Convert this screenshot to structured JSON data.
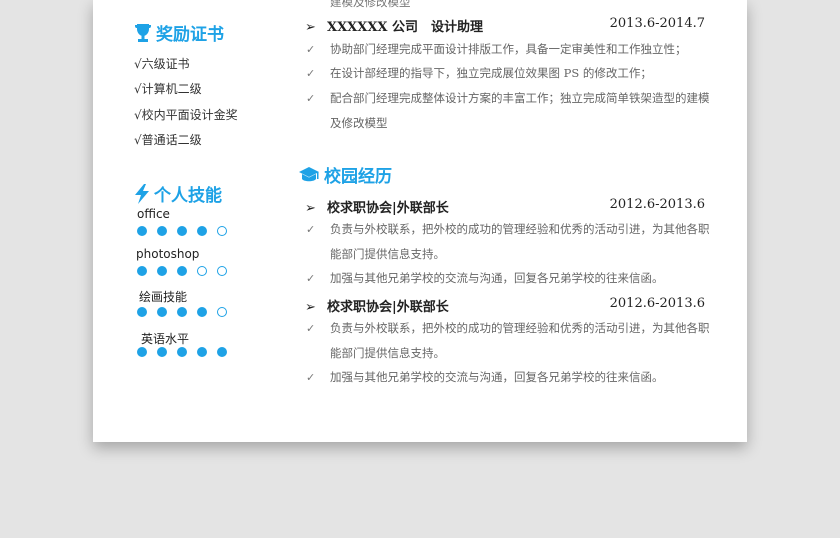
{
  "colors": {
    "accent": "#1ea2e6",
    "page_bg": "#e4e4e4",
    "paper": "#ffffff"
  },
  "top_fragment": "建模及修改模型",
  "awards": {
    "title": "奖励证书",
    "icon": "trophy-icon",
    "items": [
      "√六级证书",
      "√计算机二级",
      "√校内平面设计金奖",
      "√普通话二级"
    ]
  },
  "skills": {
    "title": "个人技能",
    "icon": "lightning-icon",
    "items": [
      {
        "name": "office",
        "level": 4,
        "max": 5
      },
      {
        "name": "photoshop",
        "level": 3,
        "max": 5
      },
      {
        "name": "绘画技能",
        "level": 4,
        "max": 5
      },
      {
        "name": "英语水平",
        "level": 5,
        "max": 5
      }
    ]
  },
  "work": {
    "company": "XXXXXX 公司　设计助理",
    "date": "2013.6-2014.7",
    "bullets": [
      "协助部门经理完成平面设计排版工作，具备一定审美性和工作独立性；",
      "在设计部经理的指导下，独立完成展位效果图 PS 的修改工作；",
      "配合部门经理完成整体设计方案的丰富工作；独立完成简单铁架造型的建模及修改模型"
    ]
  },
  "campus": {
    "title": "校园经历",
    "icon": "graduation-cap-icon",
    "entries": [
      {
        "org": "校求职协会|外联部长",
        "date": "2012.6-2013.6",
        "bullets": [
          "负责与外校联系，把外校的成功的管理经验和优秀的活动引进，为其他各职能部门提供信息支持。",
          "加强与其他兄弟学校的交流与沟通，回复各兄弟学校的往来信函。"
        ]
      },
      {
        "org": "校求职协会|外联部长",
        "date": "2012.6-2013.6",
        "bullets": [
          "负责与外校联系，把外校的成功的管理经验和优秀的活动引进，为其他各职能部门提供信息支持。",
          "加强与其他兄弟学校的交流与沟通，回复各兄弟学校的往来信函。"
        ]
      }
    ]
  }
}
